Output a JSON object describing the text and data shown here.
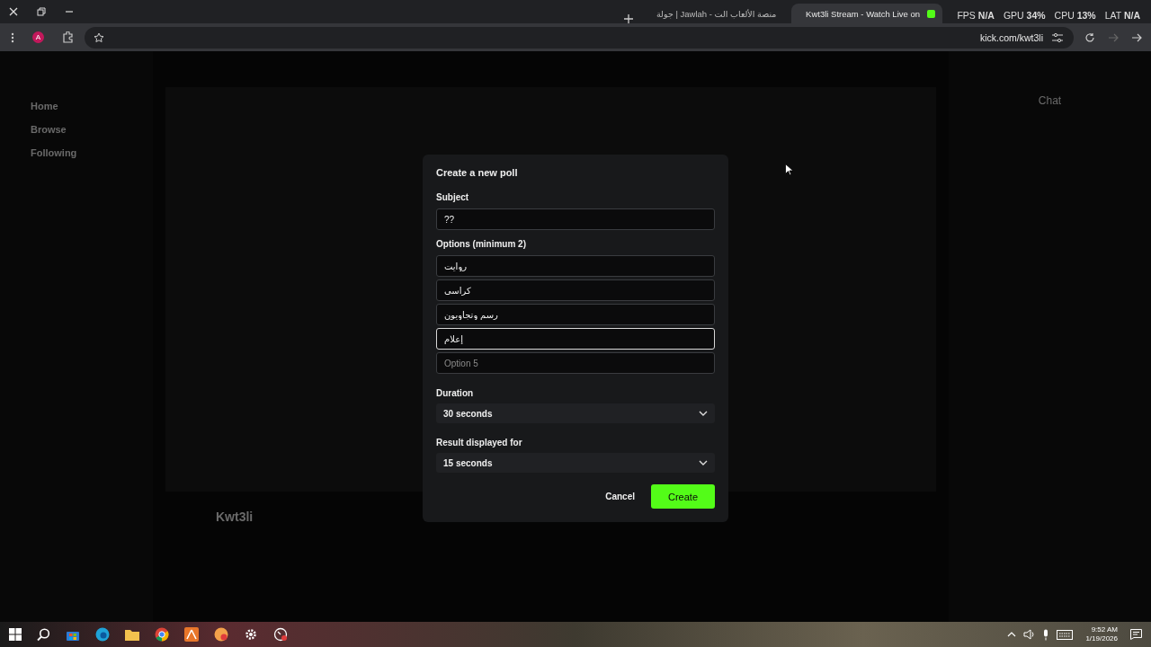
{
  "browser": {
    "tabs": [
      {
        "title": "جولة | Jawlah - منصة الألعاب الت",
        "selected": false
      },
      {
        "title": "Kwt3li Stream - Watch Live on",
        "selected": true
      }
    ],
    "profile_initial": "A",
    "url": "kick.com/kwt3li"
  },
  "perf_overlay": [
    {
      "label": "FPS",
      "value": "N/A"
    },
    {
      "label": "GPU",
      "value": "34%"
    },
    {
      "label": "CPU",
      "value": "13%"
    },
    {
      "label": "LAT",
      "value": "N/A"
    }
  ],
  "page": {
    "nav": [
      "Home",
      "Browse",
      "Following"
    ],
    "chat_title": "Chat",
    "streamer": "Kwt3li"
  },
  "dialog": {
    "title": "Create a new poll",
    "subject_label": "Subject",
    "subject_value": "??",
    "options_label": "Options (minimum 2)",
    "options": [
      {
        "value": "روايت",
        "focused": false
      },
      {
        "value": "كراسي",
        "focused": false
      },
      {
        "value": "رسم وتجاويون",
        "focused": false
      },
      {
        "value": "إعلام",
        "focused": true
      },
      {
        "placeholder": "Option 5",
        "focused": false
      }
    ],
    "duration_label": "Duration",
    "duration_value": "30 seconds",
    "result_label": "Result displayed for",
    "result_value": "15 seconds",
    "cancel": "Cancel",
    "create": "Create"
  },
  "taskbar": {
    "time": "9:52 AM",
    "date": "1/19/2026"
  }
}
